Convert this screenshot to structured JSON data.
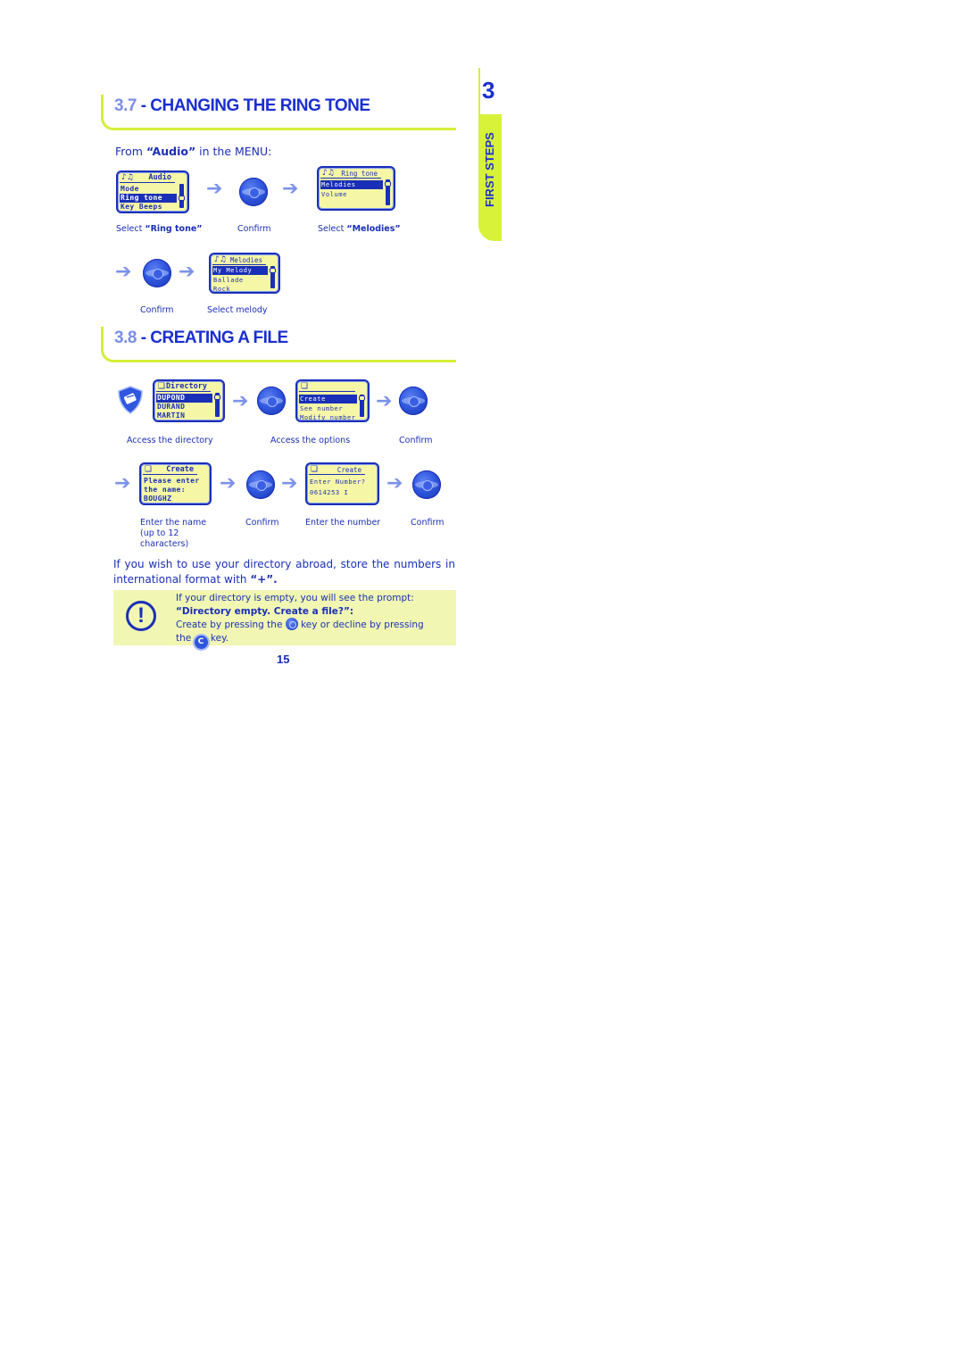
{
  "side_tab": {
    "chapter_number": "3",
    "label": "FIRST STEPS"
  },
  "section_37": {
    "number": "3.7",
    "title": "- CHANGING THE RING TONE",
    "intro_prefix": "From ",
    "intro_bold": "“Audio”",
    "intro_suffix": " in the MENU:",
    "screens": {
      "audio": {
        "header": "Audio",
        "rows": [
          "Mode",
          "Ring tone",
          "Key Beeps"
        ],
        "selected_index": 1
      },
      "ring_tone": {
        "header": "Ring tone",
        "rows": [
          "Melodies",
          "Volume"
        ],
        "selected_index": 0
      },
      "melodies": {
        "header": "Melodies",
        "rows": [
          "My Melody",
          "Ballade",
          "Rock"
        ],
        "selected_index": 0
      }
    },
    "captions": {
      "select_ring_tone_prefix": "Select ",
      "select_ring_tone_bold": "“Ring tone”",
      "confirm_1": "Confirm",
      "select_melodies_prefix": "Select ",
      "select_melodies_bold": "“Melodies”",
      "confirm_2": "Confirm",
      "select_melody": "Select melody"
    }
  },
  "section_38": {
    "number": "3.8",
    "title": "- CREATING A FILE",
    "screens": {
      "directory": {
        "header": "Directory",
        "rows": [
          "DUPOND",
          "DURAND",
          "MARTIN"
        ],
        "selected_index": 0
      },
      "options": {
        "header": "",
        "rows": [
          "Create",
          "See number",
          "Modify number"
        ],
        "selected_index": 0
      },
      "create_name": {
        "header": "Create",
        "rows": [
          "Please enter",
          "the name:",
          "BOUGHZ"
        ]
      },
      "create_number": {
        "header": "Create",
        "rows": [
          "Enter Number?",
          "0614253 I"
        ]
      }
    },
    "captions": {
      "access_directory": "Access the directory",
      "access_options": "Access the options",
      "confirm_1": "Confirm",
      "enter_name_1": "Enter the name",
      "enter_name_2": "(up to 12",
      "enter_name_3": "characters)",
      "confirm_2": "Confirm",
      "enter_number": "Enter the number",
      "confirm_3": "Confirm"
    },
    "paragraph_text": "If you wish to use your directory abroad, store the numbers in international format with ",
    "paragraph_bold": "“+”.",
    "note": {
      "icon": "exclamation-icon",
      "line1": "If your directory is empty, you will see the prompt:",
      "line2_bold": "“Directory empty. Create a file?”:",
      "line3_a": "Create by pressing the ",
      "line3_b": " key or decline by pressing",
      "line4_a": "the ",
      "c_key_label": "C",
      "line4_b": " key."
    }
  },
  "page_number": "15",
  "colors": {
    "primary_blue": "#1a2fb8",
    "accent_lime": "#d8f23a",
    "lcd_bg": "#f6f7a6",
    "note_bg": "#f1f7b2"
  }
}
